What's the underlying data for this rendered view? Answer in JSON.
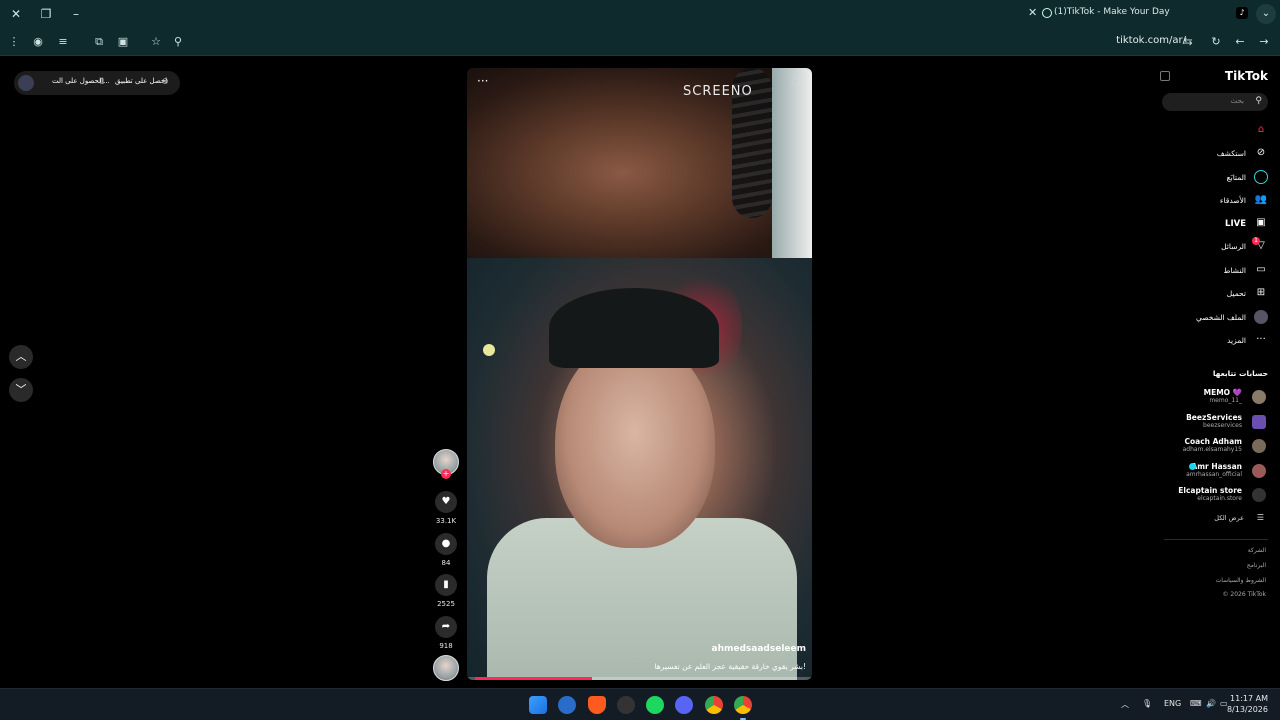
{
  "browser": {
    "tab_title": "(1)TikTok - Make Your Day",
    "url": "tiktok.com/ar/"
  },
  "promo": {
    "get_app": "احصل على تطبيق",
    "get_desktop": "الحصول على الت..."
  },
  "video": {
    "overlay_text": "SCREENO",
    "creator": "ahmedsaadseleem",
    "caption": "بشر يقوي خارقة حقيقية عجز العلم عن تفسيرها!",
    "progress_fraction": 0.34
  },
  "actions": {
    "likes": "33.1K",
    "comments": "84",
    "saves": "2525",
    "shares": "918"
  },
  "sidebar": {
    "logo": "TikTok",
    "search_placeholder": "بحث",
    "nav": [
      {
        "label": "",
        "icon": "home-icon"
      },
      {
        "label": "استكشف",
        "icon": "compass-icon"
      },
      {
        "label": "المتابَع",
        "icon": "following-icon"
      },
      {
        "label": "الأصدقاء",
        "icon": "friends-icon"
      },
      {
        "label": "LIVE",
        "icon": "live-icon"
      },
      {
        "label": "الرسائل",
        "icon": "messages-icon"
      },
      {
        "label": "النشاط",
        "icon": "activity-icon"
      },
      {
        "label": "تحميل",
        "icon": "upload-icon"
      },
      {
        "label": "الملف الشخصي",
        "icon": "profile-icon"
      },
      {
        "label": "المزيد",
        "icon": "more-icon"
      }
    ],
    "messages_badge": "1",
    "following_title": "حسابات تتابعها",
    "accounts": [
      {
        "name": "MEMO 💜",
        "handle": "memo_11_"
      },
      {
        "name": "BeezServices",
        "handle": "beezservices"
      },
      {
        "name": "Coach Adham",
        "handle": "adham.elsamahy15"
      },
      {
        "name": "Amr Hassan",
        "handle": "amrhassan_official"
      },
      {
        "name": "Elcaptain store",
        "handle": "elcaptain.store"
      }
    ],
    "see_all": "عرض الكل",
    "footer": [
      "الشركة",
      "البرنامج",
      "الشروط والسياسات",
      "© 2026 TikTok"
    ]
  },
  "taskbar": {
    "lang": "ENG",
    "time": "11:17 AM",
    "date": "8/13/2026"
  }
}
